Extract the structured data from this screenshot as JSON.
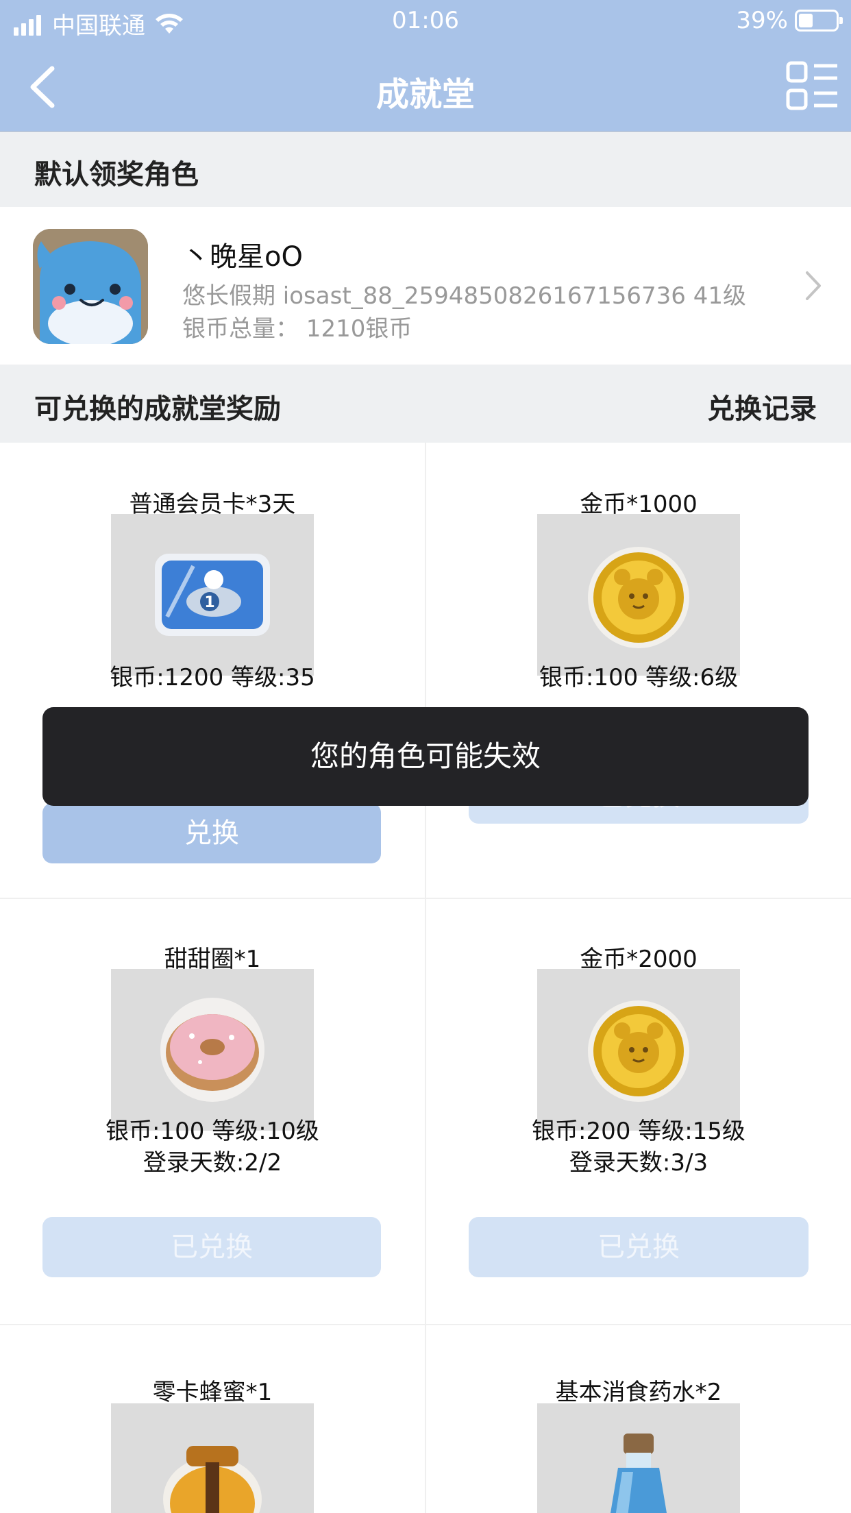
{
  "status_bar": {
    "carrier": "中国联通",
    "time": "01:06",
    "battery": "39%",
    "battery_level": 0.39
  },
  "nav": {
    "title": "成就堂"
  },
  "default_role": {
    "section_title": "默认领奖角色",
    "name": "丶晚星oO",
    "server_line": "悠长假期 iosast_88_2594850826167156736 41级",
    "silver_line": "银币总量： 1210银币"
  },
  "rewards": {
    "section_title": "可兑换的成就堂奖励",
    "history_link": "兑换记录",
    "items": [
      {
        "name": "普通会员卡*3天",
        "icon": "member-card-icon",
        "req": "银币:1200 等级:35",
        "days": "",
        "button": "兑换"
      },
      {
        "name": "金币*1000",
        "icon": "gold-coin-icon",
        "req": "银币:100 等级:6级",
        "days": "",
        "button": "已兑换"
      },
      {
        "name": "甜甜圈*1",
        "icon": "donut-icon",
        "req": "银币:100 等级:10级",
        "days": "登录天数:2/2",
        "button": "已兑换"
      },
      {
        "name": "金币*2000",
        "icon": "gold-coin-icon",
        "req": "银币:200 等级:15级",
        "days": "登录天数:3/3",
        "button": "已兑换"
      },
      {
        "name": "零卡蜂蜜*1",
        "icon": "honey-jar-icon",
        "req": "",
        "days": "",
        "button": ""
      },
      {
        "name": "基本消食药水*2",
        "icon": "potion-bottle-icon",
        "req": "",
        "days": "",
        "button": ""
      }
    ]
  },
  "toast": {
    "message": "您的角色可能失效"
  },
  "colors": {
    "nav_bg": "#a9c3e8",
    "button_active": "#a9c3e8",
    "button_done": "#d3e2f5",
    "toast_bg": "#232326"
  }
}
